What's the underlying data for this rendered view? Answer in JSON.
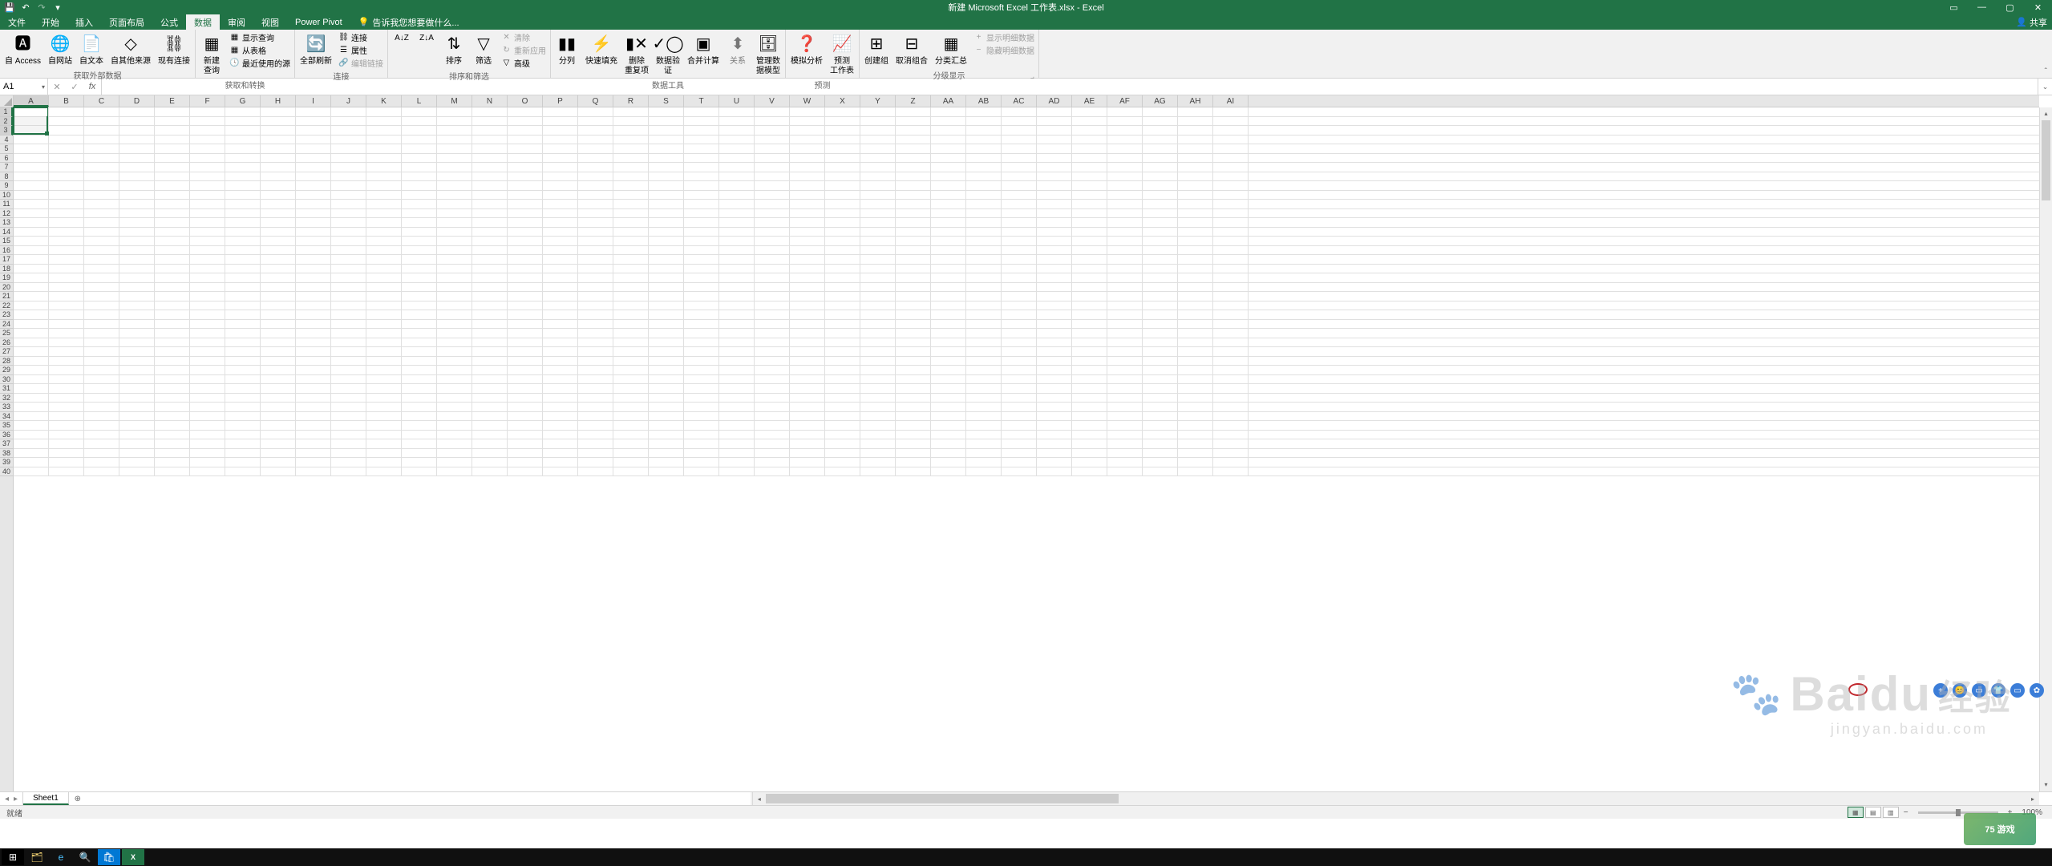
{
  "title": "新建 Microsoft Excel 工作表.xlsx - Excel",
  "qat": {
    "save": "💾",
    "undo": "↶",
    "redo": "↷",
    "more": "▾"
  },
  "win": {
    "opts": "▭",
    "min": "—",
    "max": "▢",
    "close": "✕"
  },
  "tabs": [
    "文件",
    "开始",
    "插入",
    "页面布局",
    "公式",
    "数据",
    "审阅",
    "视图",
    "Power Pivot"
  ],
  "active_tab": 5,
  "tellme": "告诉我您想要做什么...",
  "share": "共享",
  "ribbon": {
    "groups": [
      {
        "label": "获取外部数据",
        "items": [
          {
            "type": "big",
            "icon": "🅰",
            "text": "自 Access"
          },
          {
            "type": "big",
            "icon": "🌐",
            "text": "自网站"
          },
          {
            "type": "big",
            "icon": "📄",
            "text": "自文本"
          },
          {
            "type": "big",
            "icon": "◇",
            "text": "自其他来源"
          },
          {
            "type": "big",
            "icon": "⛓",
            "text": "现有连接"
          }
        ]
      },
      {
        "label": "获取和转换",
        "items": [
          {
            "type": "big",
            "icon": "▦",
            "text": "新建\n查询"
          },
          {
            "type": "stack",
            "rows": [
              {
                "icon": "▦",
                "text": "显示查询"
              },
              {
                "icon": "▦",
                "text": "从表格"
              },
              {
                "icon": "🕓",
                "text": "最近使用的源"
              }
            ]
          }
        ]
      },
      {
        "label": "连接",
        "items": [
          {
            "type": "big",
            "icon": "🔄",
            "text": "全部刷新"
          },
          {
            "type": "stack",
            "rows": [
              {
                "icon": "⛓",
                "text": "连接"
              },
              {
                "icon": "☰",
                "text": "属性"
              },
              {
                "icon": "🔗",
                "text": "编辑链接",
                "disabled": true
              }
            ]
          }
        ]
      },
      {
        "label": "排序和筛选",
        "items": [
          {
            "type": "icon",
            "icon": "A↓Z"
          },
          {
            "type": "icon",
            "icon": "Z↓A"
          },
          {
            "type": "big",
            "icon": "⇅",
            "text": "排序"
          },
          {
            "type": "big",
            "icon": "▽",
            "text": "筛选"
          },
          {
            "type": "stack",
            "rows": [
              {
                "icon": "✕",
                "text": "清除",
                "disabled": true
              },
              {
                "icon": "↻",
                "text": "重新应用",
                "disabled": true
              },
              {
                "icon": "▽",
                "text": "高级"
              }
            ]
          }
        ]
      },
      {
        "label": "数据工具",
        "items": [
          {
            "type": "big",
            "icon": "▮▮",
            "text": "分列"
          },
          {
            "type": "big",
            "icon": "⚡",
            "text": "快速填充"
          },
          {
            "type": "big",
            "icon": "▮✕",
            "text": "删除\n重复项"
          },
          {
            "type": "big",
            "icon": "✓◯",
            "text": "数据验\n证"
          },
          {
            "type": "big",
            "icon": "▣",
            "text": "合并计算"
          },
          {
            "type": "big",
            "icon": "⬍",
            "text": "关系",
            "disabled": true
          },
          {
            "type": "big",
            "icon": "🗄",
            "text": "管理数\n据模型"
          }
        ]
      },
      {
        "label": "预测",
        "items": [
          {
            "type": "big",
            "icon": "❓",
            "text": "模拟分析"
          },
          {
            "type": "big",
            "icon": "📈",
            "text": "预测\n工作表"
          }
        ]
      },
      {
        "label": "分级显示",
        "launcher": true,
        "items": [
          {
            "type": "big",
            "icon": "⊞",
            "text": "创建组"
          },
          {
            "type": "big",
            "icon": "⊟",
            "text": "取消组合"
          },
          {
            "type": "big",
            "icon": "▦",
            "text": "分类汇总"
          },
          {
            "type": "stack",
            "rows": [
              {
                "icon": "+",
                "text": "显示明细数据",
                "disabled": true
              },
              {
                "icon": "−",
                "text": "隐藏明细数据",
                "disabled": true
              }
            ]
          }
        ]
      }
    ]
  },
  "name_box": "A1",
  "fx_label": "fx",
  "columns": [
    "A",
    "B",
    "C",
    "D",
    "E",
    "F",
    "G",
    "H",
    "I",
    "J",
    "K",
    "L",
    "M",
    "N",
    "O",
    "P",
    "Q",
    "R",
    "S",
    "T",
    "U",
    "V",
    "W",
    "X",
    "Y",
    "Z",
    "AA",
    "AB",
    "AC",
    "AD",
    "AE",
    "AF",
    "AG",
    "AH",
    "AI"
  ],
  "rows": 40,
  "selection": {
    "col": 0,
    "row_start": 0,
    "row_end": 2
  },
  "sheet": {
    "name": "Sheet1",
    "add": "⊕"
  },
  "status": {
    "mode": "就绪",
    "zoom": "100%"
  },
  "watermark": {
    "brand": "Baidu",
    "suffix": "经验",
    "url": "jingyan.baidu.com"
  },
  "corner_logo": "75 游戏"
}
